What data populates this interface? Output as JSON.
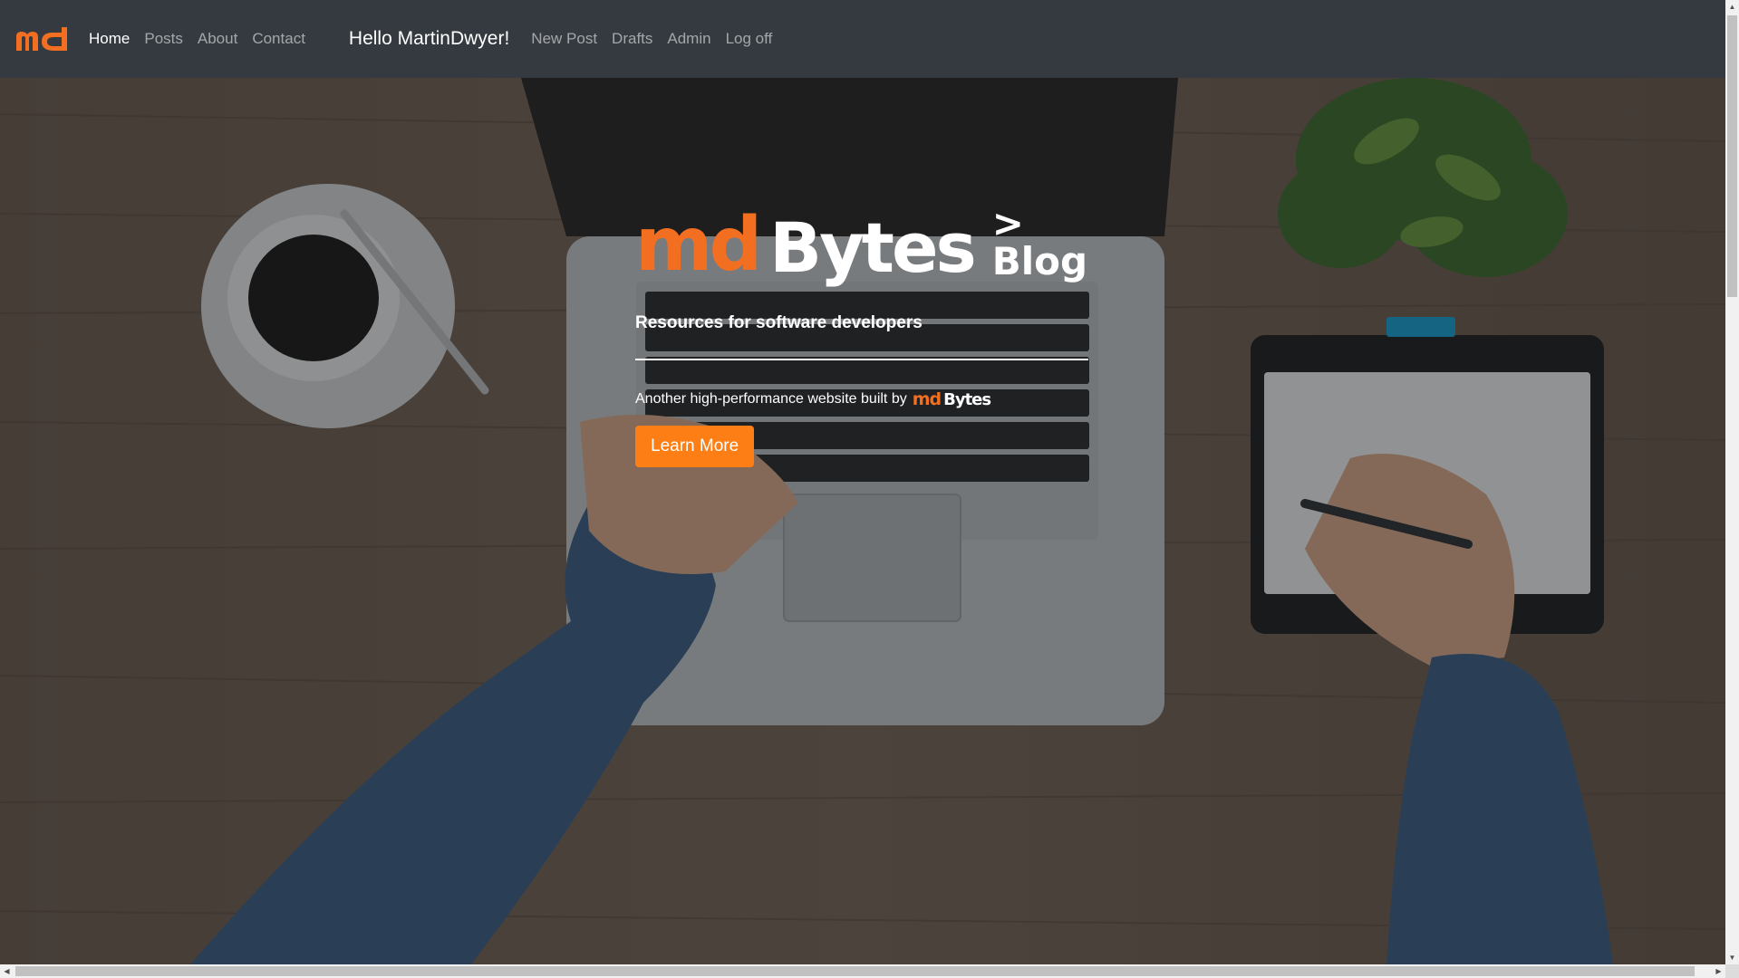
{
  "navbar": {
    "brand_text": "md",
    "links": [
      {
        "label": "Home",
        "active": true
      },
      {
        "label": "Posts",
        "active": false
      },
      {
        "label": "About",
        "active": false
      },
      {
        "label": "Contact",
        "active": false
      }
    ],
    "greeting": "Hello MartinDwyer!",
    "user_links": [
      {
        "label": "New Post"
      },
      {
        "label": "Drafts"
      },
      {
        "label": "Admin"
      },
      {
        "label": "Log off"
      }
    ]
  },
  "hero": {
    "logo_md": "md",
    "logo_bytes": "Bytes",
    "logo_suffix": "> Blog",
    "subtitle": "Resources for software developers",
    "built_by_text": "Another high-performance website built by",
    "built_by_md": "md",
    "built_by_bytes": "Bytes",
    "cta_label": "Learn More"
  },
  "colors": {
    "navbar_bg": "#343a40",
    "brand_orange": "#f26f21",
    "button_orange": "#fd7e14"
  }
}
